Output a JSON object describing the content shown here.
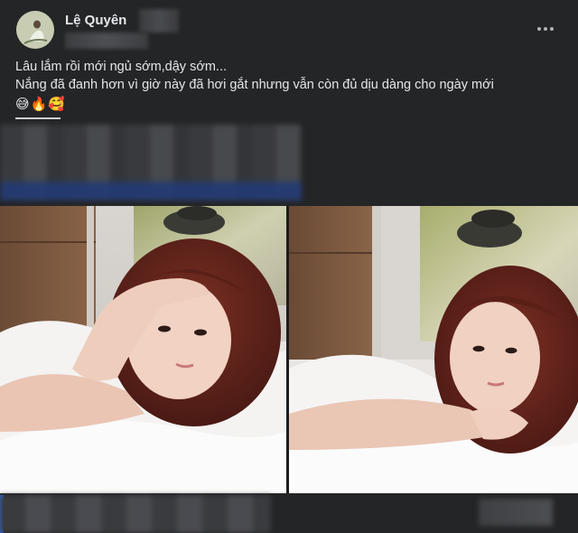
{
  "post": {
    "author": {
      "name": "Lệ Quyên"
    },
    "caption": {
      "lines": [
        "Lâu lắm rồi mới ngủ sớm,dậy sớm...",
        "Nắng đã đanh hơn vì giờ này đã hơi gắt nhưng vẫn còn đủ dịu dàng cho ngày mới"
      ],
      "emojis": [
        "😅",
        "🔥",
        "🥰"
      ]
    },
    "photos": [
      {
        "alt": "photo-left"
      },
      {
        "alt": "photo-right"
      }
    ]
  },
  "colors": {
    "background": "#242526",
    "text_primary": "#e4e6eb",
    "text_secondary": "#b0b3b8",
    "accent": "#2d6ae0"
  },
  "icons": {
    "more": "more-horizontal-icon"
  }
}
